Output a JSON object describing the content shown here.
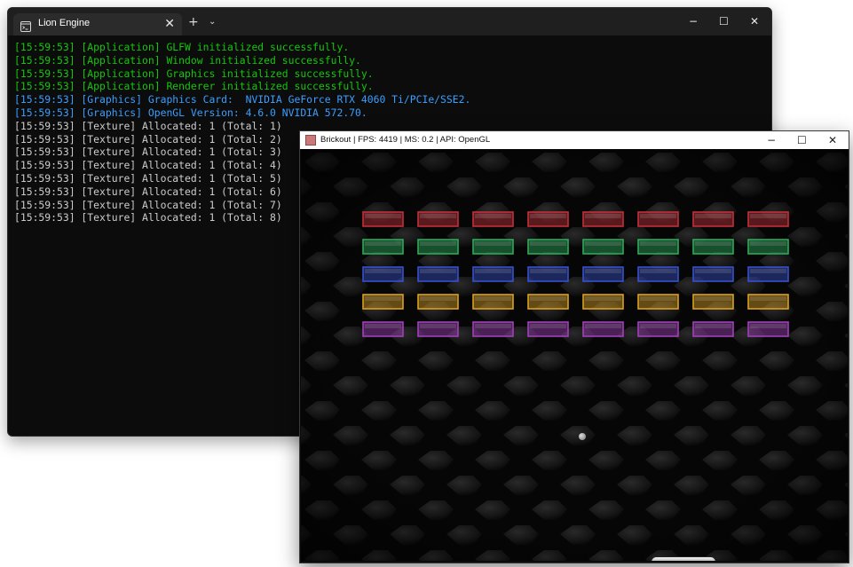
{
  "terminal": {
    "tab_title": "Lion Engine",
    "new_tab": "+",
    "tab_menu": "⌄",
    "tab_close": "✕",
    "controls": {
      "minimize": "−",
      "maximize": "☐",
      "close": "✕"
    },
    "lines": [
      {
        "text": "[15:59:53] [Application] GLFW initialized successfully.",
        "color": "green"
      },
      {
        "text": "[15:59:53] [Application] Window initialized successfully.",
        "color": "green"
      },
      {
        "text": "[15:59:53] [Application] Graphics initialized successfully.",
        "color": "green"
      },
      {
        "text": "[15:59:53] [Application] Renderer initialized successfully.",
        "color": "green"
      },
      {
        "text": "[15:59:53] [Graphics] Graphics Card:  NVIDIA GeForce RTX 4060 Ti/PCIe/SSE2.",
        "color": "blue"
      },
      {
        "text": "[15:59:53] [Graphics] OpenGL Version: 4.6.0 NVIDIA 572.70.",
        "color": "blue"
      },
      {
        "text": "[15:59:53] [Texture] Allocated: 1 (Total: 1)",
        "color": "white"
      },
      {
        "text": "[15:59:53] [Texture] Allocated: 1 (Total: 2)",
        "color": "white"
      },
      {
        "text": "[15:59:53] [Texture] Allocated: 1 (Total: 3)",
        "color": "white"
      },
      {
        "text": "[15:59:53] [Texture] Allocated: 1 (Total: 4)",
        "color": "white"
      },
      {
        "text": "[15:59:53] [Texture] Allocated: 1 (Total: 5)",
        "color": "white"
      },
      {
        "text": "[15:59:53] [Texture] Allocated: 1 (Total: 6)",
        "color": "white"
      },
      {
        "text": "[15:59:53] [Texture] Allocated: 1 (Total: 7)",
        "color": "white"
      },
      {
        "text": "[15:59:53] [Texture] Allocated: 1 (Total: 8)",
        "color": "white"
      }
    ]
  },
  "game": {
    "title": "Brickout | FPS: 4419 | MS: 0.2 | API: OpenGL",
    "controls": {
      "minimize": "−",
      "maximize": "☐",
      "close": "✕"
    },
    "brick_rows": [
      {
        "name": "red",
        "color": "#c0303a",
        "count": 8
      },
      {
        "name": "green",
        "color": "#2ea85a",
        "count": 8
      },
      {
        "name": "blue",
        "color": "#3850c8",
        "count": 8
      },
      {
        "name": "yellow",
        "color": "#d8a024",
        "count": 8
      },
      {
        "name": "purple",
        "color": "#a040b8",
        "count": 8
      }
    ]
  }
}
